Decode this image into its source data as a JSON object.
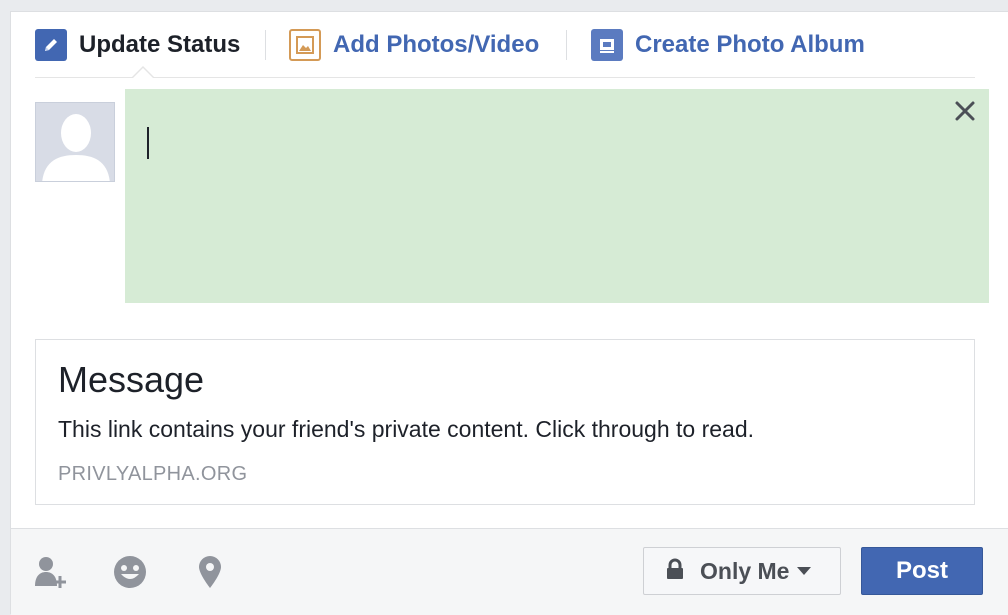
{
  "tabs": [
    {
      "label": "Update Status",
      "icon": "pencil-icon",
      "active": true
    },
    {
      "label": "Add Photos/Video",
      "icon": "photo-icon",
      "active": false
    },
    {
      "label": "Create Photo Album",
      "icon": "album-icon",
      "active": false
    }
  ],
  "composer": {
    "value": "",
    "close_icon": "close-icon",
    "background": "#d6ebd5"
  },
  "preview": {
    "title": "Message",
    "description": "This link contains your friend's private content. Click through to read.",
    "domain": "PRIVLYALPHA.ORG"
  },
  "footer": {
    "icons": [
      "tag-friends-icon",
      "emoji-icon",
      "location-icon"
    ],
    "privacy_label": "Only Me",
    "post_label": "Post"
  },
  "colors": {
    "brand": "#4267b2",
    "page_bg": "#e9ebee",
    "composer_bg": "#d6ebd5"
  }
}
